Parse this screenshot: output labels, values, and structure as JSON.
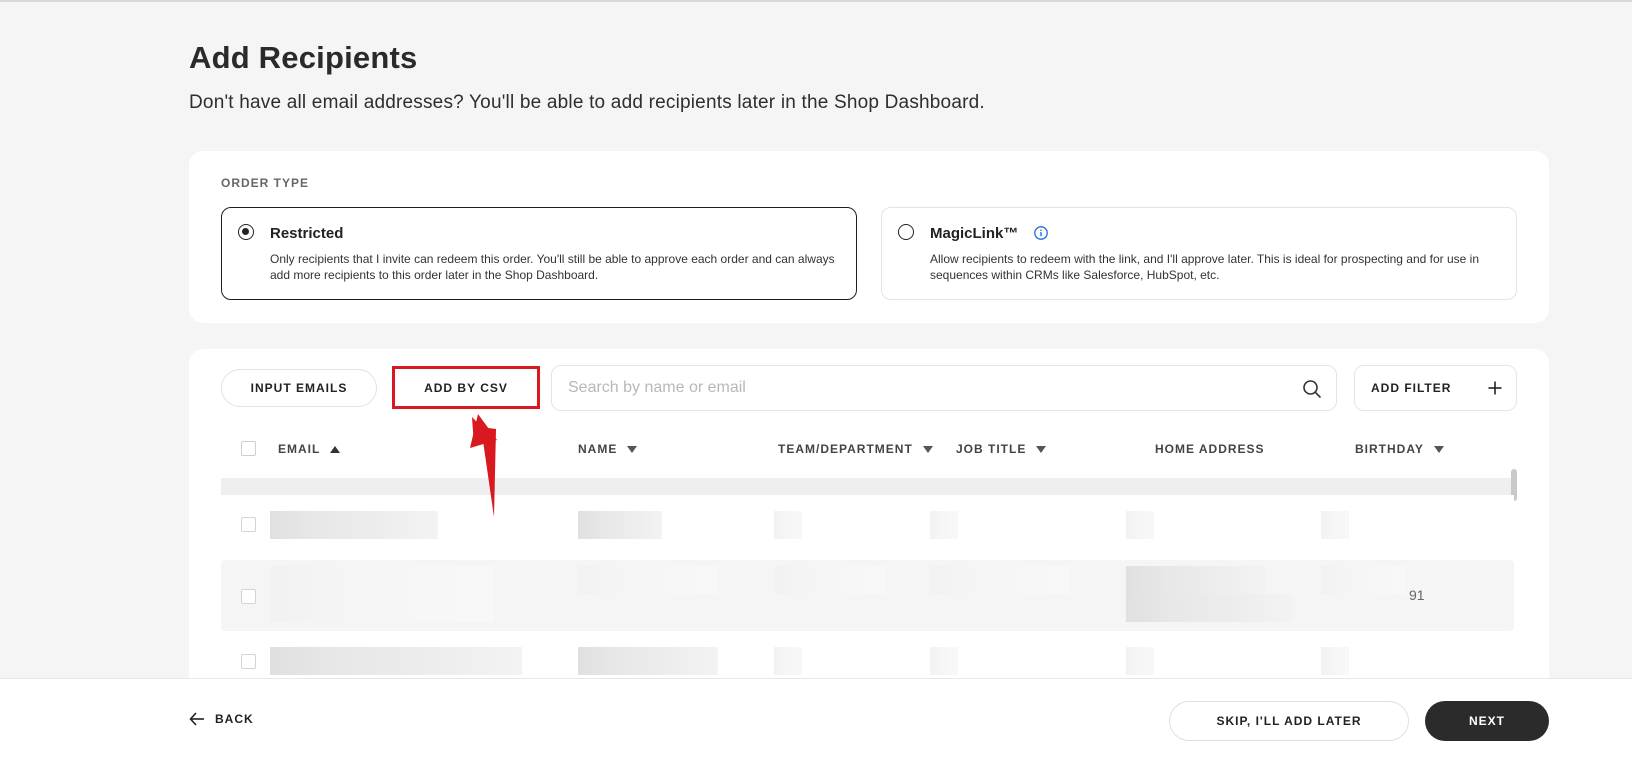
{
  "page": {
    "title": "Add Recipients",
    "subtitle": "Don't have all email addresses? You'll be able to add recipients later in the Shop Dashboard."
  },
  "order_type": {
    "label": "ORDER TYPE",
    "options": [
      {
        "title": "Restricted",
        "description": "Only recipients that I invite can redeem this order. You'll still be able to approve each order and can always add more recipients to this order later in the Shop Dashboard.",
        "selected": true
      },
      {
        "title": "MagicLink™",
        "description": "Allow recipients to redeem with the link, and I'll approve later. This is ideal for prospecting and for use in sequences within CRMs like Salesforce, HubSpot, etc.",
        "selected": false,
        "icon": "info-icon"
      }
    ]
  },
  "recipients": {
    "input_emails_label": "INPUT EMAILS",
    "add_by_csv_label": "ADD BY CSV",
    "search_placeholder": "Search by name or email",
    "add_filter_label": "ADD FILTER",
    "columns": [
      {
        "label": "EMAIL",
        "sort": "asc"
      },
      {
        "label": "NAME",
        "sort": "desc"
      },
      {
        "label": "TEAM/DEPARTMENT",
        "sort": "desc"
      },
      {
        "label": "JOB TITLE",
        "sort": "desc"
      },
      {
        "label": "HOME ADDRESS",
        "sort": null
      },
      {
        "label": "BIRTHDAY",
        "sort": "desc"
      }
    ],
    "row_visible_fragment": "91"
  },
  "footer": {
    "back_label": "BACK",
    "skip_label": "SKIP, I'LL ADD LATER",
    "next_label": "NEXT"
  },
  "colors": {
    "highlight": "#d8191f",
    "primary_dark": "#2b2b2b",
    "info_blue": "#1f6fd6"
  }
}
